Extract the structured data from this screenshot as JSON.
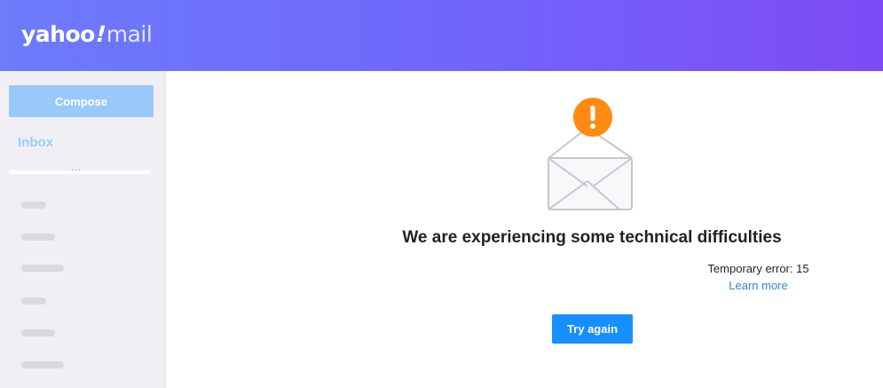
{
  "header": {
    "logo_main": "yahoo",
    "logo_bang": "!",
    "logo_sub": "mail",
    "gradient_start": "#6c7cfb",
    "gradient_end": "#7e4bf6"
  },
  "sidebar": {
    "compose_label": "Compose",
    "inbox_label": "Inbox",
    "more_label": "..."
  },
  "error": {
    "icon": "envelope-with-exclamation-icon",
    "title": "We are experiencing some technical difficulties",
    "message": "Temporary error: 15",
    "learn_more": "Learn more",
    "retry_label": "Try again",
    "accent_color": "#ff8b12",
    "button_color": "#188fff"
  }
}
